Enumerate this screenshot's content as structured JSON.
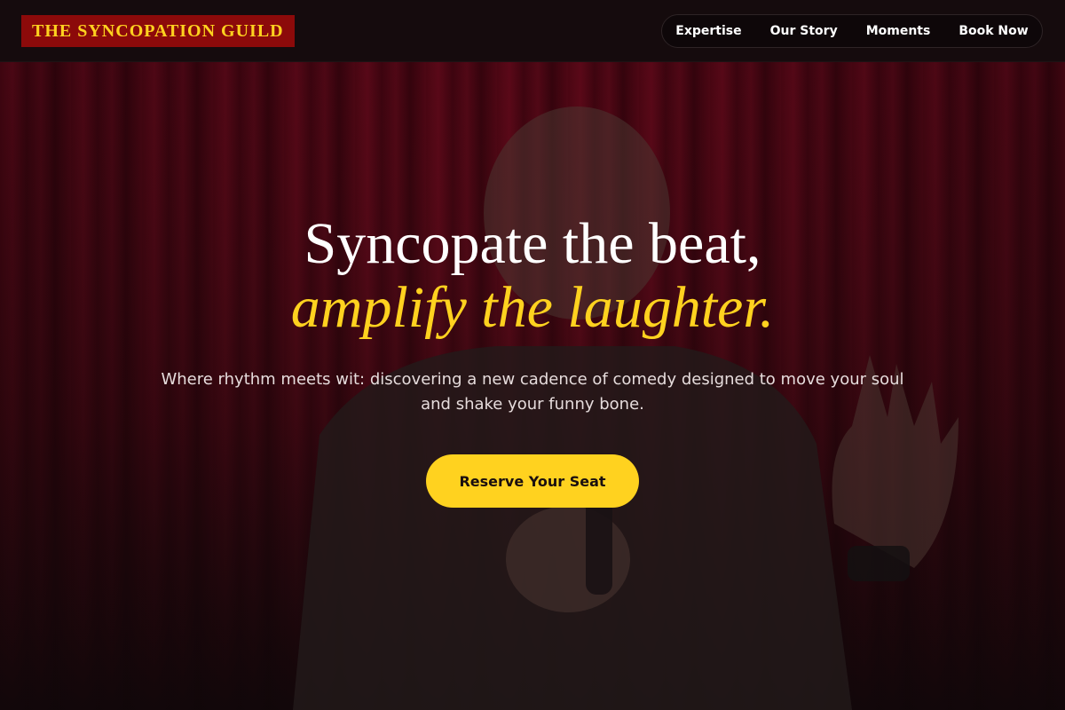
{
  "header": {
    "brand": "THE SYNCOPATION GUILD",
    "nav": [
      "Expertise",
      "Our Story",
      "Moments",
      "Book Now"
    ]
  },
  "hero": {
    "heading_line1": "Syncopate the beat,",
    "heading_line2": "amplify the laughter.",
    "subtitle": "Where rhythm meets wit: discovering a new cadence of comedy designed to move your soul and shake your funny bone.",
    "cta_label": "Reserve Your Seat"
  },
  "colors": {
    "accent": "#ffd21f",
    "brand_bg": "#8c0a0a",
    "curtain": "#5a0716",
    "header_bg": "#150b0d"
  }
}
